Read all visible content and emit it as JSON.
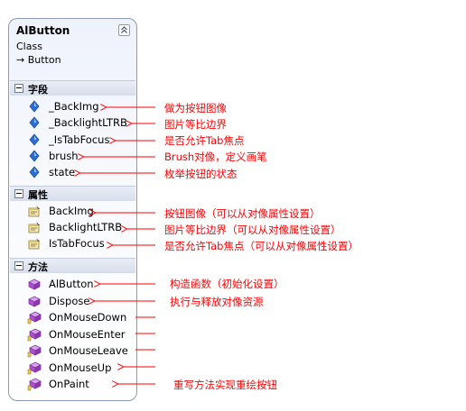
{
  "class": {
    "name": "AlButton",
    "kind": "Class",
    "base": "Button",
    "base_arrow": "→"
  },
  "sections": {
    "fields": {
      "title": "字段",
      "items": [
        {
          "name": "_BackImg",
          "icon": "private-field-icon"
        },
        {
          "name": "_BacklightLTRB",
          "icon": "private-field-icon"
        },
        {
          "name": "_IsTabFocus",
          "icon": "private-field-icon"
        },
        {
          "name": "brush",
          "icon": "private-field-icon"
        },
        {
          "name": "state",
          "icon": "private-field-icon"
        }
      ]
    },
    "properties": {
      "title": "属性",
      "items": [
        {
          "name": "BackImg",
          "icon": "property-icon"
        },
        {
          "name": "BacklightLTRB",
          "icon": "property-icon"
        },
        {
          "name": "IsTabFocus",
          "icon": "property-icon"
        }
      ]
    },
    "methods": {
      "title": "方法",
      "items": [
        {
          "name": "AlButton",
          "icon": "method-icon"
        },
        {
          "name": "Dispose",
          "icon": "method-icon"
        },
        {
          "name": "OnMouseDown",
          "icon": "protected-method-icon"
        },
        {
          "name": "OnMouseEnter",
          "icon": "protected-method-icon"
        },
        {
          "name": "OnMouseLeave",
          "icon": "protected-method-icon"
        },
        {
          "name": "OnMouseUp",
          "icon": "protected-method-icon"
        },
        {
          "name": "OnPaint",
          "icon": "protected-method-icon"
        }
      ]
    }
  },
  "annotations": {
    "backimg_field": "做为按钮图像",
    "backlight_field": "图片等比边界",
    "istabfocus_field": "是否允许Tab焦点",
    "brush_field": "Brush对像，定义画笔",
    "state_field": "枚举按钮的状态",
    "backimg_prop": "按钮图像（可以从对像属性设置）",
    "backlight_prop": "图片等比边界（可以从对像属性设置）",
    "istabfocus_prop": "是否允许Tab焦点（可以从对像属性设置）",
    "ctor": "构造函数（初始化设置）",
    "dispose": "执行与释放对像资源",
    "onpaint": "重写方法实现重绘按钮"
  },
  "colors": {
    "annotation": "#ff0000",
    "border": "#8c9bb5",
    "field_icon": "#2a6fd6",
    "method_icon": "#b14fd0"
  }
}
